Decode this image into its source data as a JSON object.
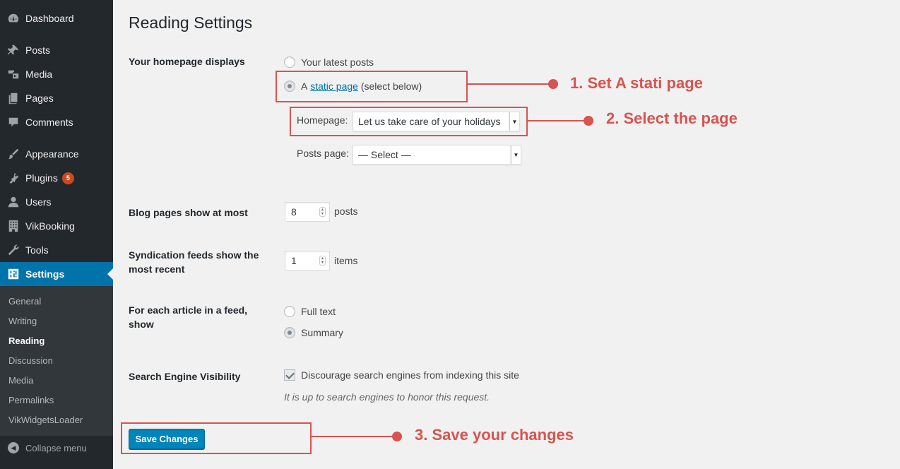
{
  "sidebar": {
    "menu": [
      {
        "label": "Dashboard",
        "icon": "dashboard-icon"
      },
      {
        "label": "Posts",
        "icon": "pin-icon"
      },
      {
        "label": "Media",
        "icon": "media-icon"
      },
      {
        "label": "Pages",
        "icon": "pages-icon"
      },
      {
        "label": "Comments",
        "icon": "comment-icon"
      },
      {
        "label": "Appearance",
        "icon": "brush-icon"
      },
      {
        "label": "Plugins",
        "icon": "plugin-icon",
        "badge": "5"
      },
      {
        "label": "Users",
        "icon": "user-icon"
      },
      {
        "label": "VikBooking",
        "icon": "building-icon"
      },
      {
        "label": "Tools",
        "icon": "wrench-icon"
      },
      {
        "label": "Settings",
        "icon": "settings-icon"
      }
    ],
    "submenu": [
      "General",
      "Writing",
      "Reading",
      "Discussion",
      "Media",
      "Permalinks",
      "VikWidgetsLoader"
    ],
    "active_submenu": "Reading",
    "collapse_label": "Collapse menu"
  },
  "page": {
    "title": "Reading Settings",
    "homepage_displays": {
      "label": "Your homepage displays",
      "option_latest": "Your latest posts",
      "option_static_prefix": "A",
      "option_static_link": "static page",
      "option_static_suffix": "(select below)",
      "selected": "static",
      "homepage_label": "Homepage:",
      "homepage_value": "Let us take care of your holidays",
      "posts_page_label": "Posts page:",
      "posts_page_value": "— Select —"
    },
    "blog_pages": {
      "label": "Blog pages show at most",
      "value": "8",
      "unit": "posts"
    },
    "syndication": {
      "label": "Syndication feeds show the most recent",
      "value": "1",
      "unit": "items"
    },
    "feed_article": {
      "label": "For each article in a feed, show",
      "option_full": "Full text",
      "option_summary": "Summary",
      "selected": "summary"
    },
    "search_visibility": {
      "label": "Search Engine Visibility",
      "checkbox_label": "Discourage search engines from indexing this site",
      "checked": true,
      "description": "It is up to search engines to honor this request."
    },
    "save_label": "Save Changes"
  },
  "annotations": {
    "step1": "1. Set A stati page",
    "step2": "2. Select the page",
    "step3": "3. Save your changes",
    "color": "#d9534f"
  },
  "colors": {
    "sidebar_bg": "#23282d",
    "accent": "#0073aa",
    "button": "#0085ba"
  }
}
